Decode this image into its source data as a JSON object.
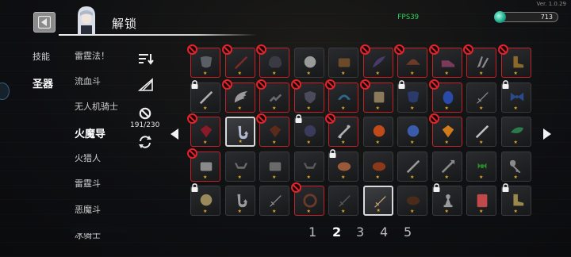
{
  "version": "Ver. 1.0.29",
  "header": {
    "title": "解锁",
    "fps": "FPS39",
    "currency_value": "713"
  },
  "tabs": [
    {
      "label": "技能"
    },
    {
      "label": "圣器"
    }
  ],
  "artifact_list": [
    {
      "label": "雷霆法！"
    },
    {
      "label": "流血斗"
    },
    {
      "label": "无人机骑士"
    },
    {
      "label": "火魔导"
    },
    {
      "label": "火猎人"
    },
    {
      "label": "雷霆斗"
    },
    {
      "label": "恶魔斗"
    },
    {
      "label": "冰骑士"
    }
  ],
  "selected_list_index": 3,
  "count": "191/230",
  "pagination": {
    "pages": [
      "1",
      "2",
      "3",
      "4",
      "5"
    ],
    "current": "2"
  },
  "colors": {
    "ban": "#e0242b",
    "star": "#e2a928",
    "fps": "#2fd35a"
  },
  "grid": [
    [
      {
        "s": "banned",
        "i": "mask",
        "c": "#5a5f66"
      },
      {
        "s": "banned",
        "i": "blade",
        "c": "#7a2a2a"
      },
      {
        "s": "banned",
        "i": "helm",
        "c": "#3a3a44"
      },
      {
        "s": "normal",
        "i": "orb",
        "c": "#9a9a9a"
      },
      {
        "s": "normal",
        "i": "box",
        "c": "#6b4a2a"
      },
      {
        "s": "banned",
        "i": "feather",
        "c": "#4a3a6a"
      },
      {
        "s": "banned",
        "i": "hat",
        "c": "#6a3a2a"
      },
      {
        "s": "banned",
        "i": "shoe",
        "c": "#7a3a5a"
      },
      {
        "s": "banned",
        "i": "claw",
        "c": "#8a8a8a"
      },
      {
        "s": "banned",
        "i": "boot",
        "c": "#8a6a2a"
      }
    ],
    [
      {
        "s": "locked",
        "i": "blade",
        "c": "#b0b0b0"
      },
      {
        "s": "banned",
        "i": "wing",
        "c": "#9a9a9a"
      },
      {
        "s": "banned",
        "i": "chain",
        "c": "#6a6a6a"
      },
      {
        "s": "banned",
        "i": "shield",
        "c": "#4a4a5a"
      },
      {
        "s": "banned",
        "i": "arc",
        "c": "#2a6a8a"
      },
      {
        "s": "banned",
        "i": "scroll",
        "c": "#8a7a5a"
      },
      {
        "s": "locked",
        "i": "mask",
        "c": "#2a3a6a"
      },
      {
        "s": "banned",
        "i": "egg",
        "c": "#2a4aaa"
      },
      {
        "s": "normal",
        "i": "sword",
        "c": "#8a8a8a"
      },
      {
        "s": "locked",
        "i": "bowtie",
        "c": "#2a4a8a"
      }
    ],
    [
      {
        "s": "banned",
        "i": "gem",
        "c": "#8a1a2a"
      },
      {
        "s": "white",
        "i": "hook",
        "c": "#b0b8d0"
      },
      {
        "s": "banned",
        "i": "gem",
        "c": "#5a2a1a"
      },
      {
        "s": "locked",
        "i": "orb",
        "c": "#3a3a5a"
      },
      {
        "s": "banned",
        "i": "bone",
        "c": "#b0b0b0"
      },
      {
        "s": "normal",
        "i": "orb",
        "c": "#c04a1a"
      },
      {
        "s": "normal",
        "i": "orb",
        "c": "#3a5aaa"
      },
      {
        "s": "banned",
        "i": "gem",
        "c": "#d07a1a"
      },
      {
        "s": "normal",
        "i": "blade",
        "c": "#c0c0c0"
      },
      {
        "s": "normal",
        "i": "leaf",
        "c": "#2a7a4a"
      }
    ],
    [
      {
        "s": "banned",
        "i": "box",
        "c": "#8a8a8a"
      },
      {
        "s": "normal",
        "i": "bow",
        "c": "#6a6a6a"
      },
      {
        "s": "normal",
        "i": "box",
        "c": "#6a6a6a"
      },
      {
        "s": "normal",
        "i": "bow",
        "c": "#5a5a5a"
      },
      {
        "s": "locked",
        "i": "meat",
        "c": "#9a5a3a"
      },
      {
        "s": "normal",
        "i": "meat",
        "c": "#8a3a1a"
      },
      {
        "s": "normal",
        "i": "blade",
        "c": "#9a9a9a"
      },
      {
        "s": "normal",
        "i": "arrow",
        "c": "#8a8a8a"
      },
      {
        "s": "normal",
        "i": "bug",
        "c": "#2a8a2a"
      },
      {
        "s": "normal",
        "i": "key",
        "c": "#8a8a8a"
      }
    ],
    [
      {
        "s": "locked",
        "i": "orb",
        "c": "#9a8a5a"
      },
      {
        "s": "normal",
        "i": "hook",
        "c": "#9a9a9a"
      },
      {
        "s": "normal",
        "i": "sword",
        "c": "#8a8a8a"
      },
      {
        "s": "banned",
        "i": "ring",
        "c": "#6a3a2a"
      },
      {
        "s": "normal",
        "i": "sword",
        "c": "#5a5a5a"
      },
      {
        "s": "white",
        "i": "sword",
        "c": "#c0a070"
      },
      {
        "s": "normal",
        "i": "meat",
        "c": "#4a2a1a"
      },
      {
        "s": "locked",
        "i": "pawn",
        "c": "#9a9a9a"
      },
      {
        "s": "normal",
        "i": "card",
        "c": "#c04a4a"
      },
      {
        "s": "locked",
        "i": "boot",
        "c": "#9a8a4a"
      }
    ]
  ]
}
